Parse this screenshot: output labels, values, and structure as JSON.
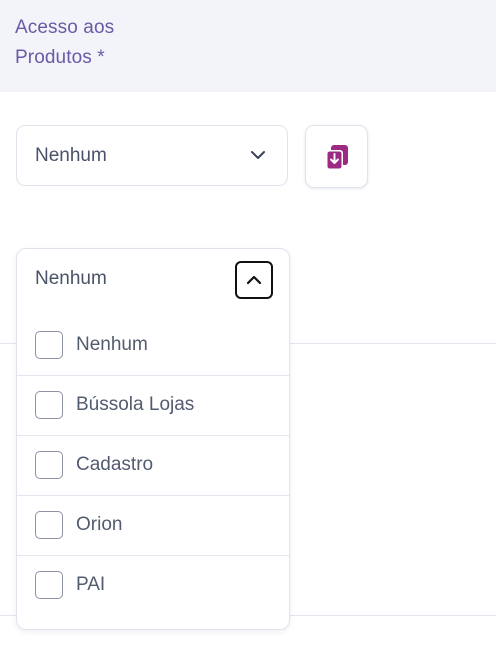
{
  "field": {
    "label": "Acesso aos Produtos *"
  },
  "select": {
    "value": "Nenhum",
    "chevron_icon": "chevron-down-icon"
  },
  "action_button": {
    "icon": "copy-download-icon",
    "accent_color": "#9c2a83"
  },
  "dropdown": {
    "value": "Nenhum",
    "collapse_icon": "chevron-up-icon",
    "options": [
      {
        "label": "Nenhum",
        "checked": false
      },
      {
        "label": "Bússola Lojas",
        "checked": false
      },
      {
        "label": "Cadastro",
        "checked": false
      },
      {
        "label": "Orion",
        "checked": false
      },
      {
        "label": "PAI",
        "checked": false
      }
    ]
  }
}
